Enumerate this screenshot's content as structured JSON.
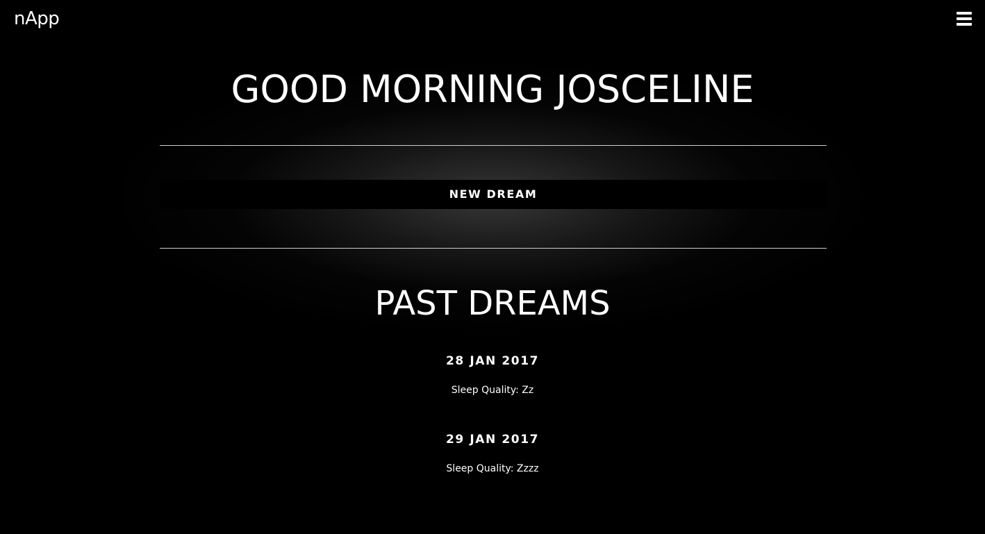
{
  "header": {
    "logo": "nApp",
    "menu_icon": "hamburger-menu-icon"
  },
  "main": {
    "greeting": "GOOD MORNING JOSCELINE",
    "new_dream_label": "NEW DREAM",
    "past_title": "PAST DREAMS",
    "dreams": [
      {
        "date": "28 JAN 2017",
        "quality": "Sleep Quality: Zz"
      },
      {
        "date": "29 JAN 2017",
        "quality": "Sleep Quality: Zzzz"
      }
    ]
  },
  "colors": {
    "background": "#000000",
    "text": "#ffffff",
    "divider": "#cfcfcf",
    "glow": "#3a3a3a"
  }
}
